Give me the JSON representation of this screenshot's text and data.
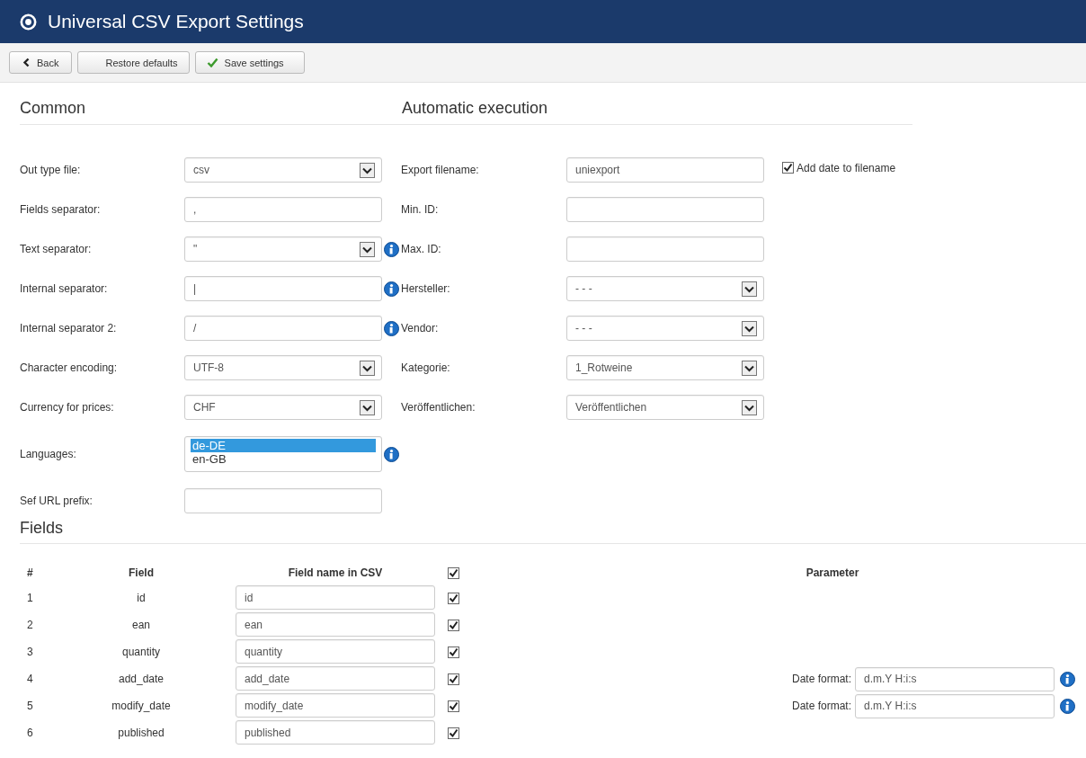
{
  "header": {
    "title": "Universal CSV Export Settings"
  },
  "toolbar": {
    "buttons": [
      {
        "label": "Back",
        "kind": "back"
      },
      {
        "label": "Restore defaults",
        "kind": "plain"
      },
      {
        "label": "Save settings",
        "kind": "save"
      }
    ]
  },
  "common": {
    "heading": "Common",
    "rows": [
      {
        "label": "Out type file:",
        "kind": "select",
        "value": "csv",
        "info": false
      },
      {
        "label": "Fields separator:",
        "kind": "input",
        "value": ",",
        "info": false
      },
      {
        "label": "Text separator:",
        "kind": "select",
        "value": "\"",
        "info": true
      },
      {
        "label": "Internal separator:",
        "kind": "input",
        "value": "|",
        "info": true
      },
      {
        "label": "Internal separator 2:",
        "kind": "input",
        "value": "/",
        "info": true
      },
      {
        "label": "Character encoding:",
        "kind": "select",
        "value": "UTF-8",
        "info": false
      },
      {
        "label": "Currency for prices:",
        "kind": "select",
        "value": "CHF",
        "info": false
      },
      {
        "label": "Languages:",
        "kind": "listbox",
        "info": true,
        "options": [
          {
            "label": "de-DE",
            "selected": true
          },
          {
            "label": "en-GB",
            "selected": false
          }
        ]
      },
      {
        "label": "Sef URL prefix:",
        "kind": "input",
        "value": "",
        "info": false
      }
    ]
  },
  "automatic": {
    "heading": "Automatic execution",
    "rows": [
      {
        "label": "Export filename:",
        "kind": "input",
        "value": "uniexport",
        "checkbox": {
          "label": "Add date to filename",
          "checked": true
        }
      },
      {
        "label": "Min. ID:",
        "kind": "input",
        "value": ""
      },
      {
        "label": "Max. ID:",
        "kind": "input",
        "value": ""
      },
      {
        "label": "Hersteller:",
        "kind": "select",
        "value": "- - -"
      },
      {
        "label": "Vendor:",
        "kind": "select",
        "value": "- - -"
      },
      {
        "label": "Kategorie:",
        "kind": "select",
        "value": "1_Rotweine"
      },
      {
        "label": "Veröffentlichen:",
        "kind": "select",
        "value": "Veröffentlichen"
      }
    ]
  },
  "fields": {
    "heading": "Fields",
    "columns": {
      "number": "#",
      "field": "Field",
      "csv_name": "Field name in CSV",
      "parameter": "Parameter"
    },
    "all_checked": true,
    "rows": [
      {
        "number": "1",
        "field": "id",
        "csv_name": "id",
        "checked": true
      },
      {
        "number": "2",
        "field": "ean",
        "csv_name": "ean",
        "checked": true
      },
      {
        "number": "3",
        "field": "quantity",
        "csv_name": "quantity",
        "checked": true
      },
      {
        "number": "4",
        "field": "add_date",
        "csv_name": "add_date",
        "checked": true,
        "parameter": {
          "label": "Date format:",
          "value": "d.m.Y H:i:s",
          "info": true
        }
      },
      {
        "number": "5",
        "field": "modify_date",
        "csv_name": "modify_date",
        "checked": true,
        "parameter": {
          "label": "Date format:",
          "value": "d.m.Y H:i:s",
          "info": true
        }
      },
      {
        "number": "6",
        "field": "published",
        "csv_name": "published",
        "checked": true
      }
    ]
  }
}
